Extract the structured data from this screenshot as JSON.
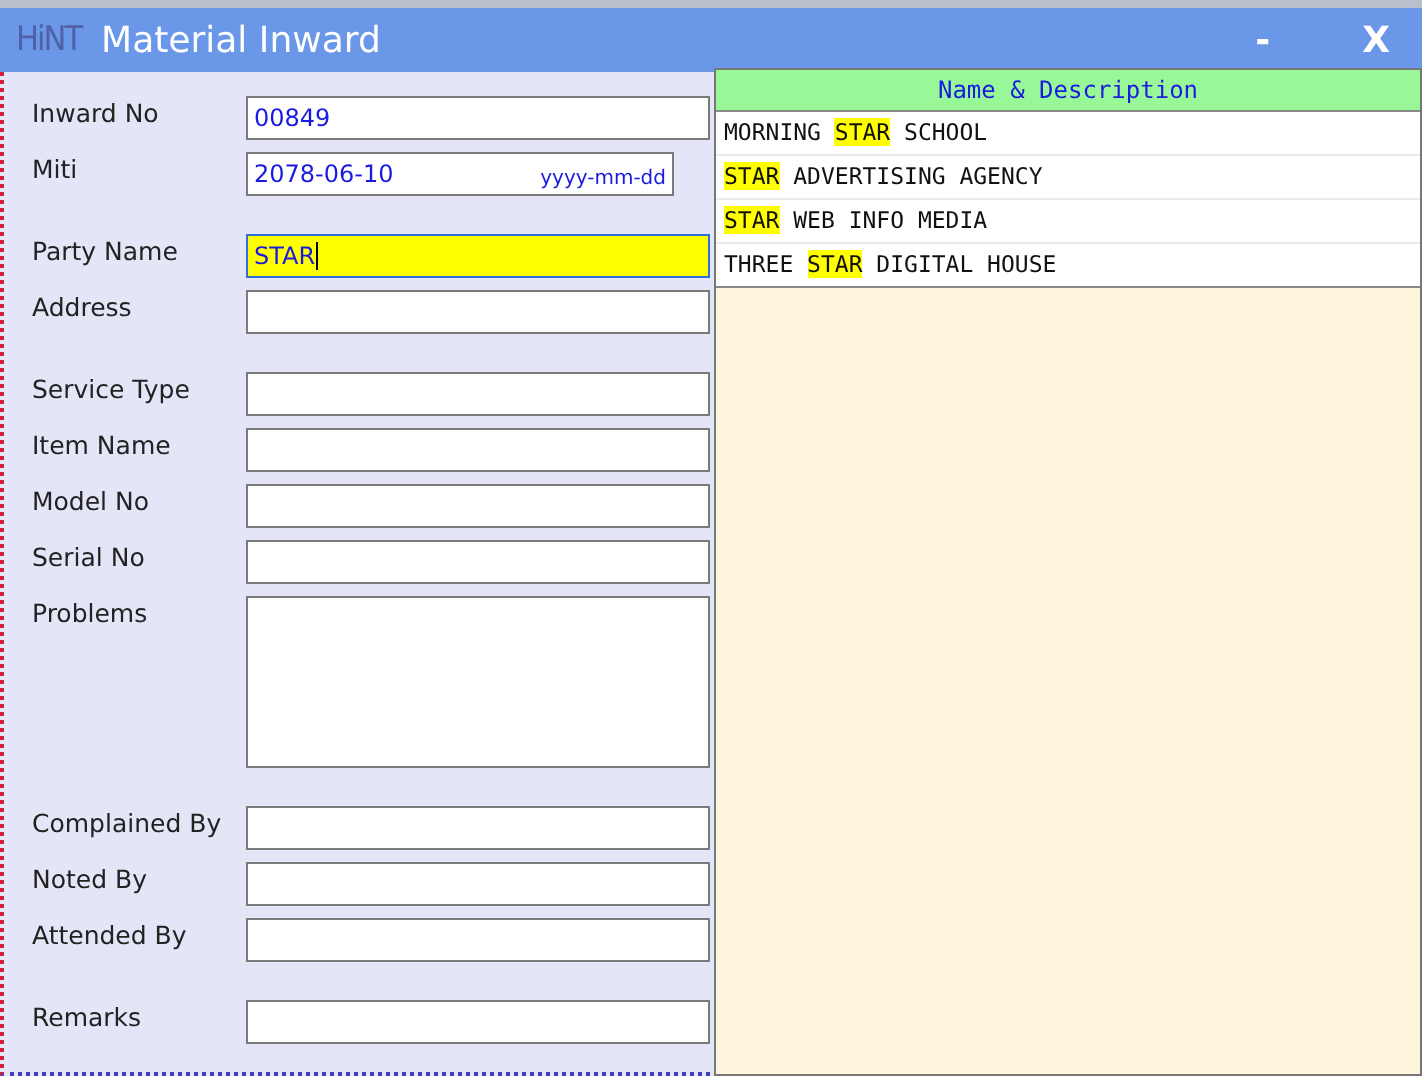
{
  "window": {
    "logo": "HiNT",
    "title": "Material Inward",
    "minimize": "-",
    "close": "X"
  },
  "sections": [
    [
      {
        "label": "Inward No",
        "kind": "text",
        "value": "00849",
        "focused": false
      },
      {
        "label": "Miti",
        "kind": "date",
        "value": "2078-06-10",
        "format_hint": "yyyy-mm-dd",
        "focused": false
      }
    ],
    [
      {
        "label": "Party Name",
        "kind": "text",
        "value": "STAR",
        "focused": true
      },
      {
        "label": "Address",
        "kind": "text",
        "focused": false
      }
    ],
    [
      {
        "label": "Service Type",
        "kind": "text",
        "focused": false
      },
      {
        "label": "Item Name",
        "kind": "text",
        "focused": false
      },
      {
        "label": "Model No",
        "kind": "text",
        "focused": false
      },
      {
        "label": "Serial No",
        "kind": "text",
        "focused": false
      },
      {
        "label": "Problems",
        "kind": "textarea",
        "focused": false
      }
    ],
    [
      {
        "label": "Complained By",
        "kind": "text",
        "focused": false
      },
      {
        "label": "Noted By",
        "kind": "text",
        "focused": false
      },
      {
        "label": "Attended By",
        "kind": "text",
        "focused": false
      }
    ],
    [
      {
        "label": "Remarks",
        "kind": "text",
        "focused": false
      }
    ]
  ],
  "lookup": {
    "header": "Name & Description",
    "rows": [
      {
        "parts": [
          {
            "text": "MORNING ",
            "match": false
          },
          {
            "text": "STAR",
            "match": true
          },
          {
            "text": " SCHOOL",
            "match": false
          }
        ]
      },
      {
        "parts": [
          {
            "text": "STAR",
            "match": true
          },
          {
            "text": " ADVERTISING AGENCY",
            "match": false
          }
        ]
      },
      {
        "parts": [
          {
            "text": "STAR",
            "match": true
          },
          {
            "text": " WEB INFO MEDIA",
            "match": false
          }
        ]
      },
      {
        "parts": [
          {
            "text": "THREE ",
            "match": false
          },
          {
            "text": "STAR",
            "match": true
          },
          {
            "text": " DIGITAL HOUSE",
            "match": false
          }
        ]
      }
    ]
  }
}
